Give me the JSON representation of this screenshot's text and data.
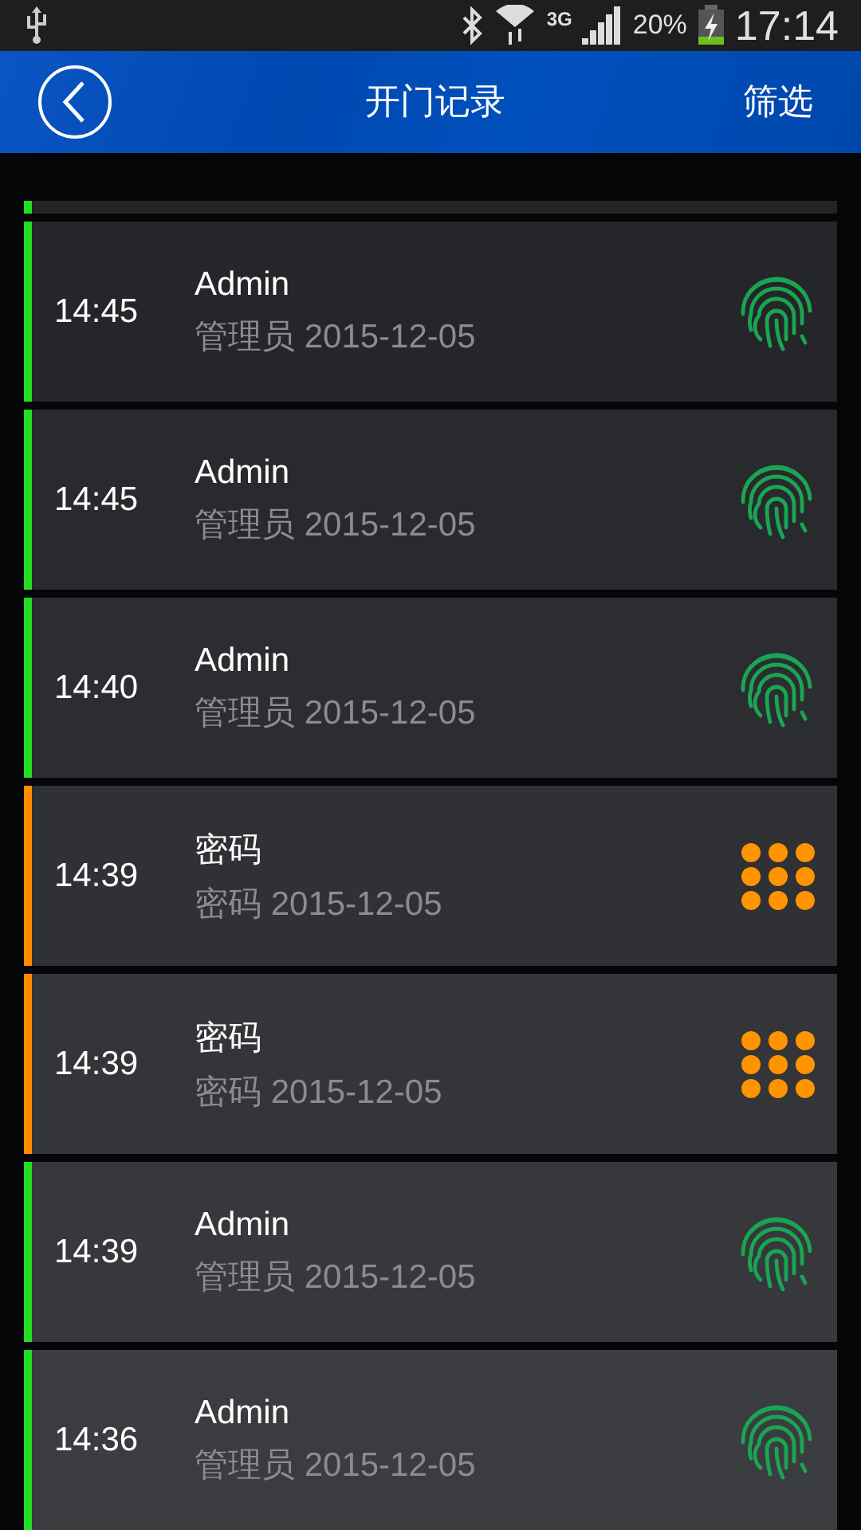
{
  "status_bar": {
    "battery": "20%",
    "network": "3G",
    "time": "17:14"
  },
  "header": {
    "title": "开门记录",
    "action": "筛选"
  },
  "top_strip": {
    "color": "#22dd22"
  },
  "records": [
    {
      "time": "14:45",
      "name": "Admin",
      "detail": "管理员 2015-12-05",
      "kind": "fingerprint",
      "color": "#22dd22"
    },
    {
      "time": "14:45",
      "name": "Admin",
      "detail": "管理员 2015-12-05",
      "kind": "fingerprint",
      "color": "#22dd22"
    },
    {
      "time": "14:40",
      "name": "Admin",
      "detail": "管理员 2015-12-05",
      "kind": "fingerprint",
      "color": "#22dd22"
    },
    {
      "time": "14:39",
      "name": "密码",
      "detail": "密码 2015-12-05",
      "kind": "keypad",
      "color": "#ff8c00"
    },
    {
      "time": "14:39",
      "name": "密码",
      "detail": "密码 2015-12-05",
      "kind": "keypad",
      "color": "#ff8c00"
    },
    {
      "time": "14:39",
      "name": "Admin",
      "detail": "管理员 2015-12-05",
      "kind": "fingerprint",
      "color": "#22dd22"
    },
    {
      "time": "14:36",
      "name": "Admin",
      "detail": "管理员 2015-12-05",
      "kind": "fingerprint",
      "color": "#22dd22"
    }
  ]
}
